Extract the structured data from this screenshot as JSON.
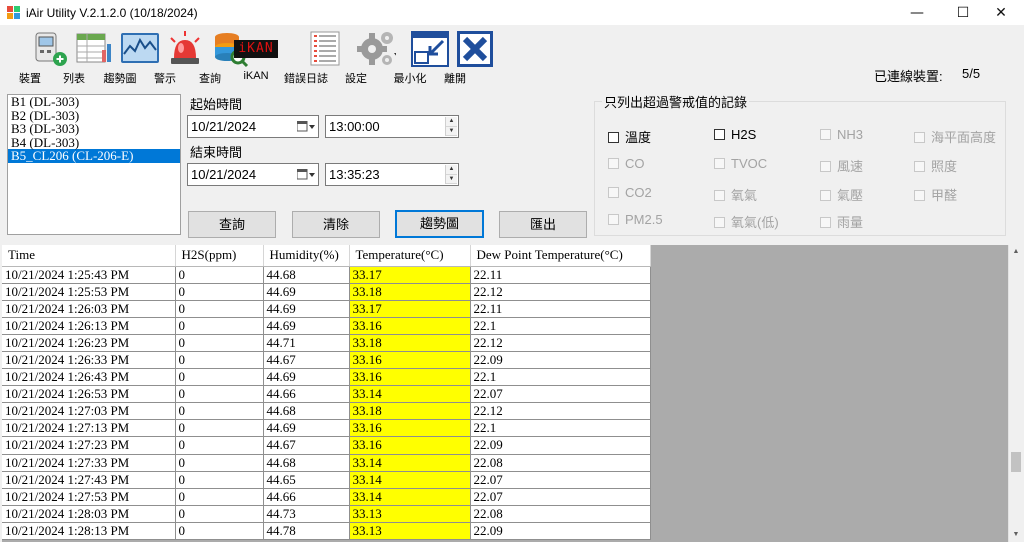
{
  "window": {
    "title": "iAir Utility V.2.1.2.0 (10/18/2024)",
    "minimize_glyph": "—",
    "maximize_glyph": "☐",
    "close_glyph": "✕"
  },
  "toolbar": {
    "items": [
      {
        "label": "裝置",
        "icon": "device-icon"
      },
      {
        "label": "列表",
        "icon": "list-icon"
      },
      {
        "label": "趨勢圖",
        "icon": "trend-icon"
      },
      {
        "label": "警示",
        "icon": "alarm-icon"
      },
      {
        "label": "查詢",
        "icon": "query-icon"
      },
      {
        "label": "iKAN",
        "icon": "ikan-icon"
      },
      {
        "label": "錯誤日誌",
        "icon": "error-log-icon"
      },
      {
        "label": "設定",
        "icon": "settings-icon"
      },
      {
        "label": "最小化",
        "icon": "minimize-icon"
      },
      {
        "label": "離開",
        "icon": "exit-icon"
      }
    ],
    "ikan_text": "iKAN",
    "connected_label": "已連線裝置:",
    "connected_value": "5/5"
  },
  "devices": [
    "B1 (DL-303)",
    "B2 (DL-303)",
    "B3 (DL-303)",
    "B4 (DL-303)",
    "B5_CL206 (CL-206-E)"
  ],
  "selected_device_index": 4,
  "time": {
    "start_label": "起始時間",
    "start_date": "10/21/2024",
    "start_time": "13:00:00",
    "end_label": "結束時間",
    "end_date": "10/21/2024",
    "end_time": "13:35:23"
  },
  "buttons": {
    "query": "查詢",
    "clear": "清除",
    "trend": "趨勢圖",
    "export": "匯出"
  },
  "filter": {
    "title": "只列出超過警戒值的記錄",
    "options": [
      {
        "label": "溫度",
        "enabled": true
      },
      {
        "label": "H2S",
        "enabled": true
      },
      {
        "label": "NH3",
        "enabled": false
      },
      {
        "label": "海平面高度",
        "enabled": false
      },
      {
        "label": "CO",
        "enabled": false
      },
      {
        "label": "TVOC",
        "enabled": false
      },
      {
        "label": "風速",
        "enabled": false
      },
      {
        "label": "照度",
        "enabled": false
      },
      {
        "label": "CO2",
        "enabled": false
      },
      {
        "label": "氧氣",
        "enabled": false
      },
      {
        "label": "氣壓",
        "enabled": false
      },
      {
        "label": "甲醛",
        "enabled": false
      },
      {
        "label": "PM2.5",
        "enabled": false
      },
      {
        "label": "氧氣(低)",
        "enabled": false
      },
      {
        "label": "雨量",
        "enabled": false
      }
    ]
  },
  "table": {
    "columns": [
      "Time",
      "H2S(ppm)",
      "Humidity(%)",
      "Temperature(°C)",
      "Dew Point Temperature(°C)"
    ],
    "highlight_column": 3,
    "highlight_color": "#ffff00",
    "rows": [
      [
        "10/21/2024 1:25:43 PM",
        "0",
        "44.68",
        "33.17",
        "22.11"
      ],
      [
        "10/21/2024 1:25:53 PM",
        "0",
        "44.69",
        "33.18",
        "22.12"
      ],
      [
        "10/21/2024 1:26:03 PM",
        "0",
        "44.69",
        "33.17",
        "22.11"
      ],
      [
        "10/21/2024 1:26:13 PM",
        "0",
        "44.69",
        "33.16",
        "22.1"
      ],
      [
        "10/21/2024 1:26:23 PM",
        "0",
        "44.71",
        "33.18",
        "22.12"
      ],
      [
        "10/21/2024 1:26:33 PM",
        "0",
        "44.67",
        "33.16",
        "22.09"
      ],
      [
        "10/21/2024 1:26:43 PM",
        "0",
        "44.69",
        "33.16",
        "22.1"
      ],
      [
        "10/21/2024 1:26:53 PM",
        "0",
        "44.66",
        "33.14",
        "22.07"
      ],
      [
        "10/21/2024 1:27:03 PM",
        "0",
        "44.68",
        "33.18",
        "22.12"
      ],
      [
        "10/21/2024 1:27:13 PM",
        "0",
        "44.69",
        "33.16",
        "22.1"
      ],
      [
        "10/21/2024 1:27:23 PM",
        "0",
        "44.67",
        "33.16",
        "22.09"
      ],
      [
        "10/21/2024 1:27:33 PM",
        "0",
        "44.68",
        "33.14",
        "22.08"
      ],
      [
        "10/21/2024 1:27:43 PM",
        "0",
        "44.65",
        "33.14",
        "22.07"
      ],
      [
        "10/21/2024 1:27:53 PM",
        "0",
        "44.66",
        "33.14",
        "22.07"
      ],
      [
        "10/21/2024 1:28:03 PM",
        "0",
        "44.73",
        "33.13",
        "22.08"
      ],
      [
        "10/21/2024 1:28:13 PM",
        "0",
        "44.78",
        "33.13",
        "22.09"
      ]
    ]
  },
  "colors": {
    "selection": "#0078d7",
    "grid_empty": "#ababab"
  }
}
